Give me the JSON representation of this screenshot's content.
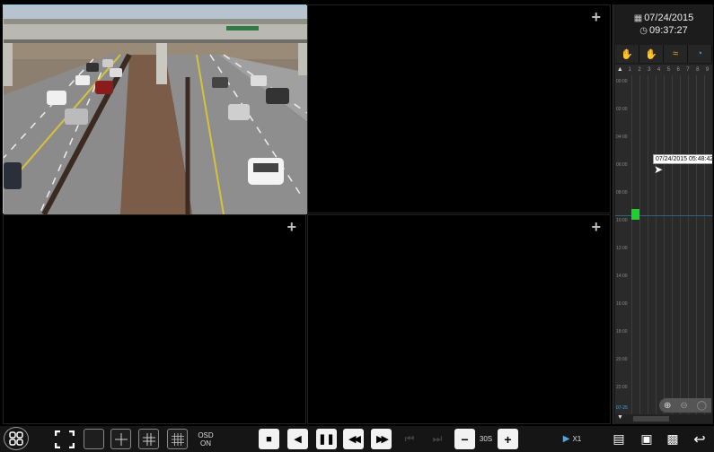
{
  "panel": {
    "date": "07/24/2015",
    "time": "09:37:27",
    "record_types": [
      {
        "name": "manual",
        "icon": "hand-icon",
        "color": "#2e9e2e"
      },
      {
        "name": "sensor",
        "icon": "sensor-icon",
        "color": "#d23b3b"
      },
      {
        "name": "motion",
        "icon": "motion-icon",
        "color": "#d9b420"
      },
      {
        "name": "schedule",
        "icon": "schedule-icon",
        "color": "#3a9ad9"
      }
    ],
    "channels": [
      "1",
      "2",
      "3",
      "4",
      "5",
      "6",
      "7",
      "8",
      "9"
    ],
    "time_ticks": [
      "00:00",
      "02:00",
      "04:00",
      "06:00",
      "08:00",
      "10:00",
      "12:00",
      "14:00",
      "16:00",
      "18:00",
      "20:00",
      "22:00"
    ],
    "bottom_stamp": "07-25",
    "tooltip": "07/24/2015 05:48:42"
  },
  "toolbar": {
    "osd_line1": "OSD",
    "osd_line2": "ON",
    "step_label": "30S",
    "speed_label": "X1"
  },
  "colors": {
    "accent": "#7fd3e8",
    "record_green": "#1bd12a"
  }
}
